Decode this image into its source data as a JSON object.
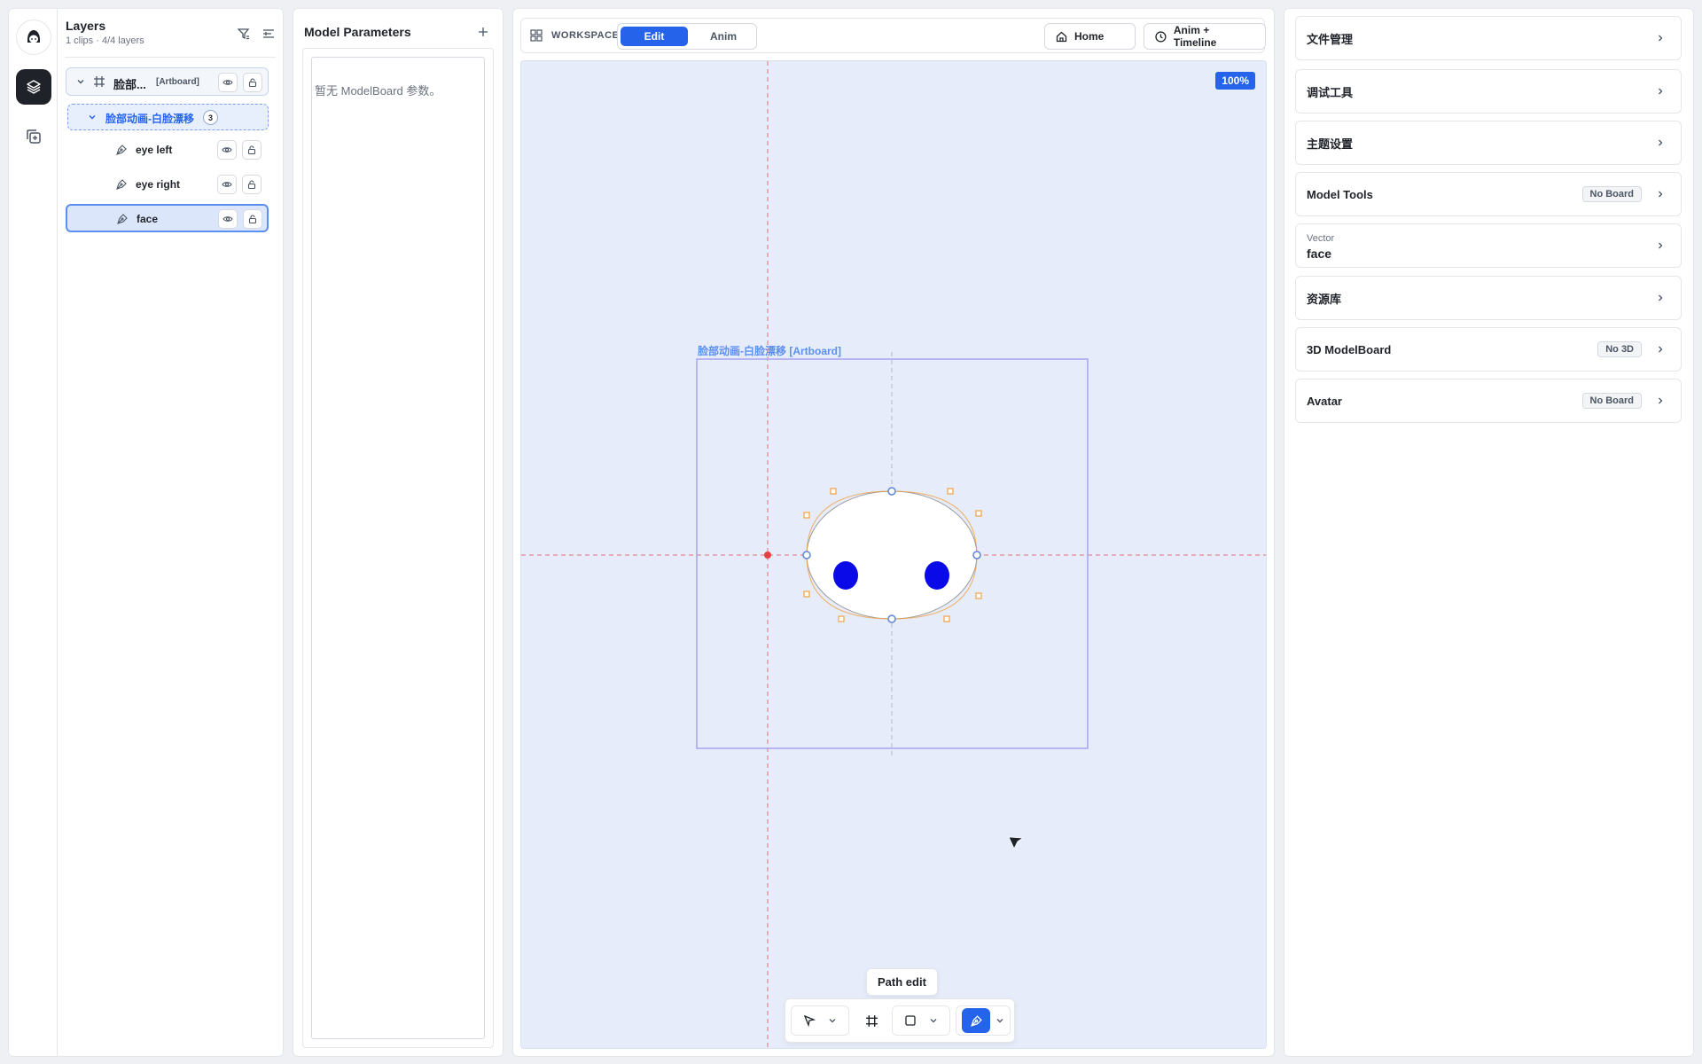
{
  "layers": {
    "title": "Layers",
    "subtitle": "1 clips · 4/4 layers",
    "artboard": {
      "name": "脸部...",
      "tag": "[Artboard]"
    },
    "group": {
      "name": "脸部动画-白脸漂移",
      "count": "3"
    },
    "items": [
      {
        "name": "eye left"
      },
      {
        "name": "eye right"
      },
      {
        "name": "face"
      }
    ]
  },
  "params": {
    "title": "Model Parameters",
    "empty_text": "暂无 ModelBoard 参数。"
  },
  "toolbar": {
    "workspace_label": "WORKSPACE",
    "mode_edit": "Edit",
    "mode_anim": "Anim",
    "home_label": "Home",
    "timeline_label": "Anim + Timeline"
  },
  "canvas": {
    "zoom": "100%",
    "artboard_label": "脸部动画-白脸漂移 [Artboard]",
    "tooltip": "Path edit"
  },
  "right": {
    "file_mgmt": "文件管理",
    "debug_tools": "调试工具",
    "theme": "主题设置",
    "model_tools": "Model Tools",
    "model_tools_badge": "No Board",
    "vector_label": "Vector",
    "vector_value": "face",
    "assets": "资源库",
    "modelboard_3d": "3D ModelBoard",
    "modelboard_3d_badge": "No 3D",
    "avatar": "Avatar",
    "avatar_badge": "No Board"
  },
  "colors": {
    "accent": "#2563eb",
    "eyes": "#0a0ae8",
    "handles": "#f0a040",
    "guide": "#e8707a",
    "artboard_border": "#a9a3f0"
  }
}
